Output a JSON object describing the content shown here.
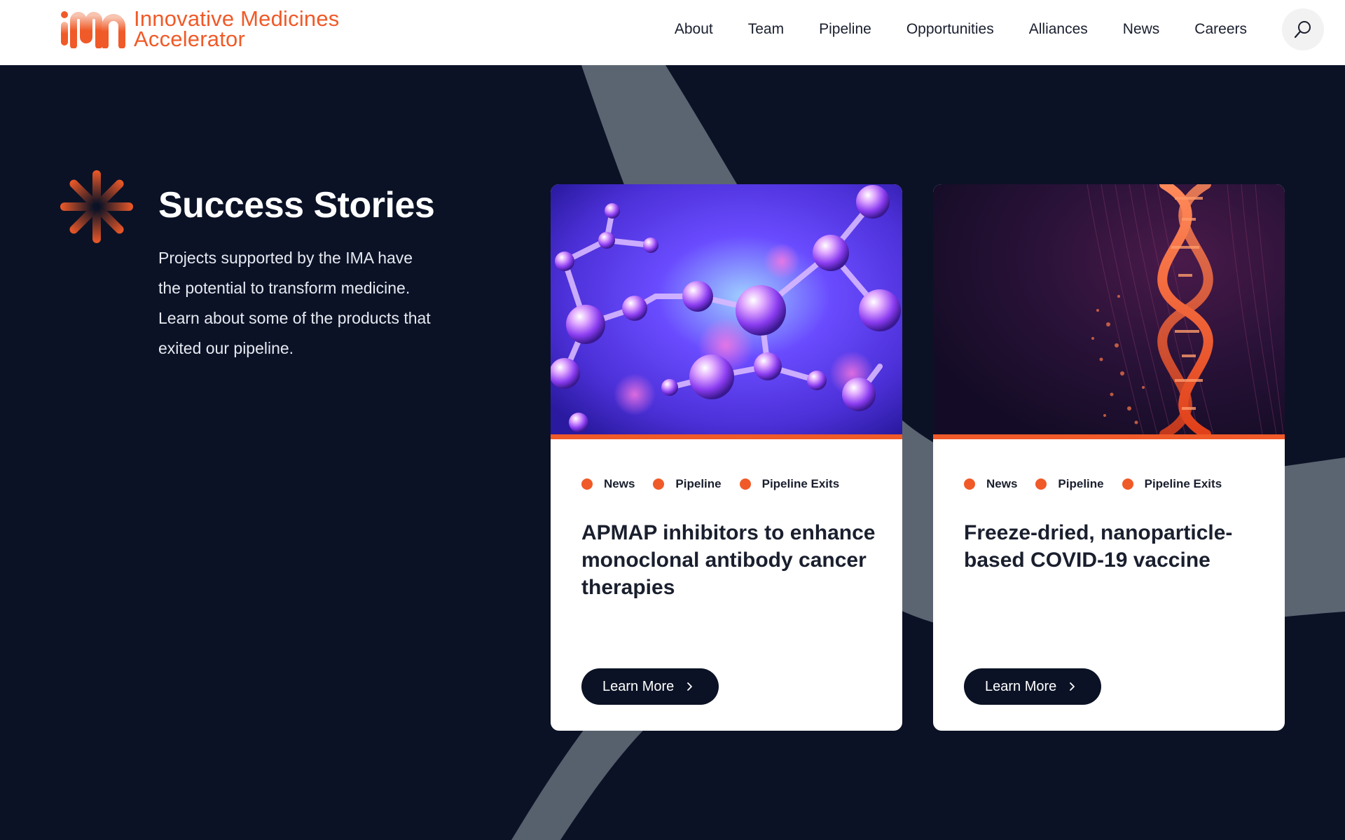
{
  "brand": {
    "name_line1": "Innovative Medicines",
    "name_line2": "Accelerator",
    "accent_color": "#f05a28",
    "dark_color": "#0b1226"
  },
  "nav": {
    "items": [
      "About",
      "Team",
      "Pipeline",
      "Opportunities",
      "Alliances",
      "News",
      "Careers"
    ],
    "search_icon": "search-icon"
  },
  "intro": {
    "title": "Success Stories",
    "description": "Projects supported by the IMA have the potential to transform medicine. Learn about some of the products that exited our pipeline.",
    "icon": "starburst-icon"
  },
  "cards": [
    {
      "image": "molecules-image",
      "tags": [
        "News",
        "Pipeline",
        "Pipeline Exits"
      ],
      "title": "APMAP inhibitors to enhance monoclonal antibody cancer therapies",
      "button_label": "Learn More"
    },
    {
      "image": "dna-helix-image",
      "tags": [
        "News",
        "Pipeline",
        "Pipeline Exits"
      ],
      "title": "Freeze-dried, nanoparticle-based COVID-19 vaccine",
      "button_label": "Learn More"
    }
  ]
}
